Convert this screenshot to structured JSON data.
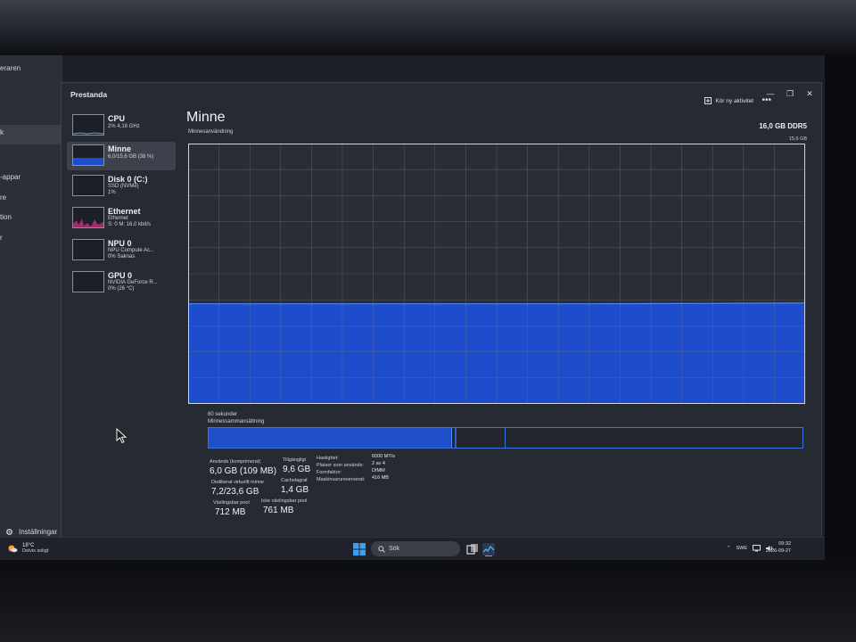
{
  "back_window": {
    "title_fragment": "eraren",
    "nav_fragments": [
      "k",
      "-appar",
      "re",
      "tion",
      "r"
    ],
    "settings_label": "Inställningar"
  },
  "window": {
    "title": "Prestanda",
    "controls": [
      "—",
      "❐",
      "✕"
    ]
  },
  "sidebar": {
    "items": [
      {
        "name": "CPU",
        "sub1": "2% 4,18 GHz",
        "sub2": ""
      },
      {
        "name": "Minne",
        "sub1": "6,0/15,6 GB (38 %)",
        "sub2": ""
      },
      {
        "name": "Disk 0 (C:)",
        "sub1": "SSD (NVMe)",
        "sub2": "1%"
      },
      {
        "name": "Ethernet",
        "sub1": "Ethernet",
        "sub2": "S: 0 M: 16,0 kbit/s"
      },
      {
        "name": "NPU 0",
        "sub1": "NPU Compute Ac...",
        "sub2": "0% Saknas"
      },
      {
        "name": "GPU 0",
        "sub1": "NVIDIA GeForce R...",
        "sub2": "0% (26 °C)"
      }
    ]
  },
  "header": {
    "run_task": "Kör ny aktivitet",
    "more": "•••"
  },
  "main": {
    "title": "Minne",
    "chart_label": "Minnesanvändning",
    "spec": "16,0 GB DDR5",
    "max": "15,6 GB",
    "time_label": "60 sekunder",
    "composition_label": "Minnessammansättning"
  },
  "chart_data": {
    "type": "area",
    "ylabel": "",
    "ylim": [
      0,
      15.6
    ],
    "x": [
      0,
      10,
      20,
      30,
      40,
      50,
      60
    ],
    "series": [
      {
        "values": [
          6.0,
          6.0,
          6.0,
          6.0,
          6.0,
          6.02,
          6.05
        ]
      }
    ],
    "grid": true,
    "color": "#1d4ccc"
  },
  "composition": {
    "total_gb": 15.6,
    "in_use_gb": 6.0,
    "modified_gb": 0.1,
    "standby_gb": 1.4
  },
  "stats": {
    "in_use_label": "Används (komprimerat)",
    "in_use_value": "6,0 GB (109 MB)",
    "available_label": "Tillgängligt",
    "available_value": "9,6 GB",
    "committed_label": "Dedikerat virtuellt minne",
    "committed_value": "7,2/23,6 GB",
    "cached_label": "Cachelagrat",
    "cached_value": "1,4 GB",
    "paged_label": "Växlingsbar pool",
    "paged_value": "712 MB",
    "nonpaged_label": "Icke växlingsbar pool",
    "nonpaged_value": "761 MB"
  },
  "specs": [
    {
      "label": "Hastighet:",
      "value": "6000 MT/s"
    },
    {
      "label": "Platser som används:",
      "value": "2 av 4"
    },
    {
      "label": "Formfaktor:",
      "value": "DIMM"
    },
    {
      "label": "Maskinvarureserverat:",
      "value": "416 MB"
    }
  ],
  "taskbar": {
    "weather_temp": "18°C",
    "weather_desc": "Delvis soligt",
    "search_text": "Sök",
    "lang": "SWE",
    "time": "09:32",
    "date": "2026-09-27"
  }
}
